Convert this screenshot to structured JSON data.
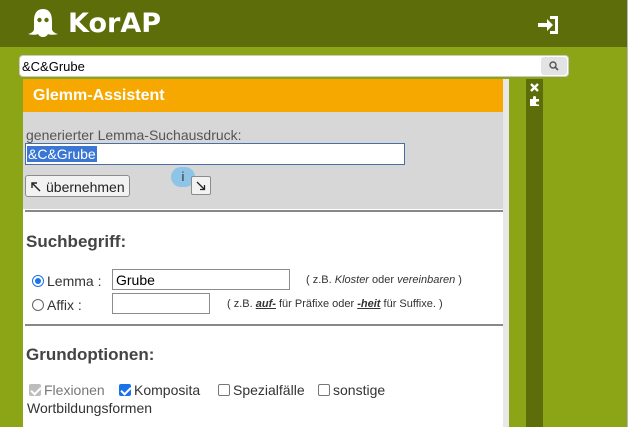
{
  "header": {
    "app_name": "KorAP",
    "login_icon": "login-icon"
  },
  "search": {
    "value": "&C&Grube",
    "search_icon": "search-icon"
  },
  "assistant": {
    "title": "Glemm-Assistent",
    "generated_label": "generierter Lemma-Suchausdruck:",
    "generated_value": "&C&Grube",
    "apply_label": "übernehmen",
    "info_label": "i",
    "close_icon": "close-icon",
    "plugin_icon": "puzzle-icon"
  },
  "search_term": {
    "heading": "Suchbegriff:",
    "lemma_label": "Lemma :",
    "lemma_value": "Grube",
    "lemma_selected": true,
    "lemma_hint_prefix": "( z.B.",
    "lemma_hint_ex1": "Kloster",
    "lemma_hint_mid": "oder",
    "lemma_hint_ex2": "vereinbaren",
    "lemma_hint_suffix": ")",
    "affix_label": "Affix :",
    "affix_value": "",
    "affix_selected": false,
    "affix_hint_prefix": "( z.B.",
    "affix_hint_ex1": "auf-",
    "affix_hint_mid": "für Präfixe oder",
    "affix_hint_ex2": "-heit",
    "affix_hint_suffix": "für Suffixe. )"
  },
  "basic_options": {
    "heading": "Grundoptionen:",
    "options": [
      {
        "label": "Flexionen",
        "checked": true,
        "disabled": true
      },
      {
        "label": "Komposita",
        "checked": true,
        "disabled": false
      },
      {
        "label": "Spezialfälle",
        "checked": false,
        "disabled": false
      },
      {
        "label": "sonstige",
        "checked": false,
        "disabled": false
      }
    ],
    "continuation": "Wortbildungsformen"
  },
  "colors": {
    "header_bg": "#5d6d0a",
    "page_bg": "#8ba516",
    "title_bg": "#f6a800",
    "accent": "#1a73e8"
  }
}
